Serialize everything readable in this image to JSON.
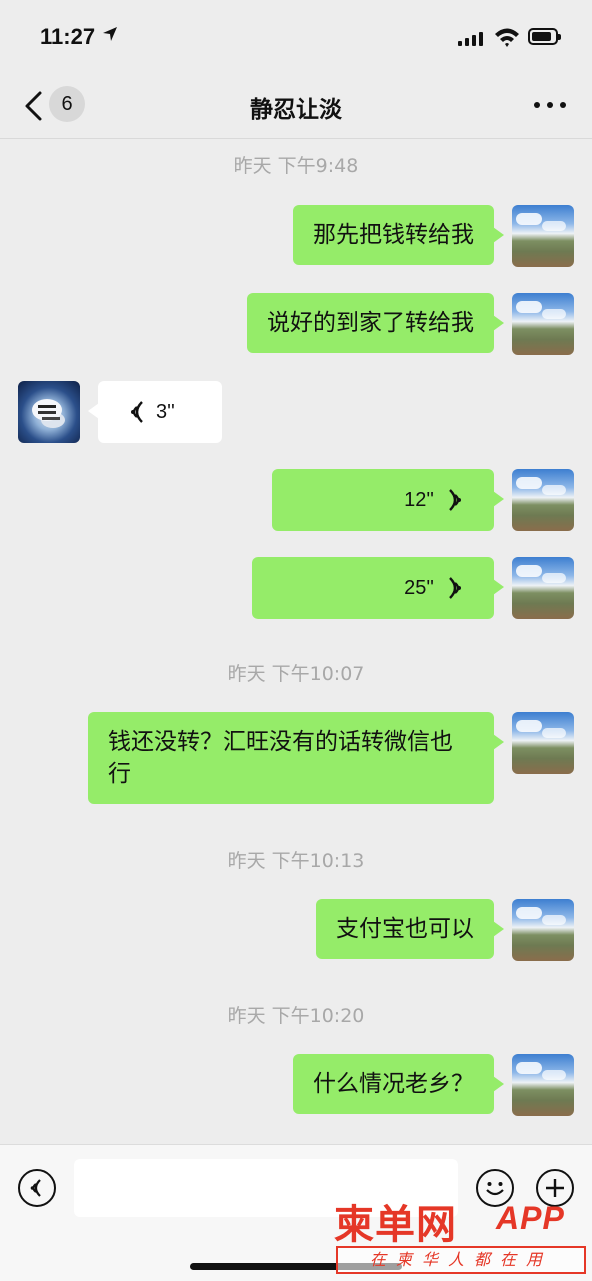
{
  "status_bar": {
    "time": "11:27",
    "location_arrow": "location-arrow-icon",
    "battery_level": 0.85
  },
  "nav": {
    "back_badge": "6",
    "title": "静忍让淡",
    "more": "more-dots-icon"
  },
  "chat": {
    "timestamps": [
      "昨天 下午9:48",
      "昨天 下午10:07",
      "昨天 下午10:13",
      "昨天 下午10:20"
    ],
    "messages": [
      {
        "from": "me",
        "type": "text",
        "text": "那先把钱转给我"
      },
      {
        "from": "me",
        "type": "text",
        "text": "说好的到家了转给我"
      },
      {
        "from": "them",
        "type": "voice",
        "duration": "3''"
      },
      {
        "from": "me",
        "type": "voice",
        "duration": "12''"
      },
      {
        "from": "me",
        "type": "voice",
        "duration": "25''"
      },
      {
        "from": "me",
        "type": "text",
        "text": "钱还没转？汇旺没有的话转微信也行"
      },
      {
        "from": "me",
        "type": "text",
        "text": "支付宝也可以"
      },
      {
        "from": "me",
        "type": "text",
        "text": "什么情况老乡？"
      }
    ]
  },
  "input_bar": {
    "voice_toggle": "voice-icon",
    "emoji": "emoji-icon",
    "plus": "plus-icon"
  },
  "watermark": {
    "logo": "柬单网",
    "app": "APP",
    "slogan": "在柬华人都在用"
  },
  "colors": {
    "background": "#ededed",
    "my_bubble": "#95ec69",
    "their_bubble": "#ffffff",
    "timestamp": "#a8a8a8",
    "watermark": "#e53727"
  }
}
